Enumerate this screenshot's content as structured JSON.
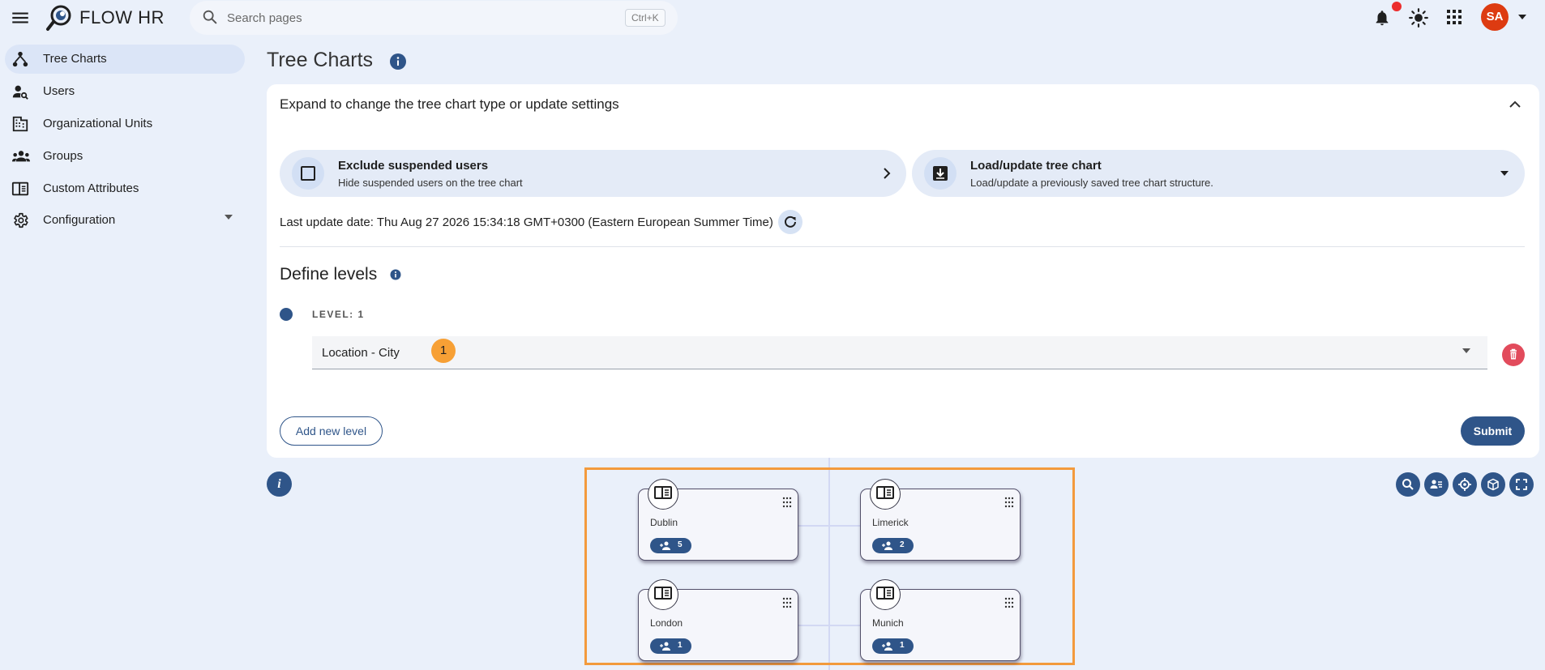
{
  "app": {
    "title": "FLOW HR"
  },
  "search": {
    "placeholder": "Search pages",
    "shortcut": "Ctrl+K"
  },
  "user": {
    "initials": "SA"
  },
  "colors": {
    "primary": "#2f5589",
    "accent": "#f39a3c",
    "danger": "#e24b5c",
    "avatar": "#dd3b11",
    "notification": "#ec2d2d"
  },
  "sidebar": {
    "items": [
      {
        "label": "Tree Charts",
        "icon": "tree-chart-icon",
        "active": true
      },
      {
        "label": "Users",
        "icon": "user-search-icon"
      },
      {
        "label": "Organizational Units",
        "icon": "building-icon"
      },
      {
        "label": "Groups",
        "icon": "groups-icon"
      },
      {
        "label": "Custom Attributes",
        "icon": "attributes-icon"
      },
      {
        "label": "Configuration",
        "icon": "gear-icon"
      }
    ]
  },
  "page": {
    "title": "Tree Charts"
  },
  "settings": {
    "expand_text": "Expand to change the tree chart type or update settings",
    "exclude": {
      "title": "Exclude suspended users",
      "subtitle": "Hide suspended users on the tree chart"
    },
    "load": {
      "title": "Load/update tree chart",
      "subtitle": "Load/update a previously saved tree chart structure."
    },
    "last_update": "Last update date: Thu Aug 27 2026 15:34:18 GMT+0300 (Eastern European Summer Time)"
  },
  "levels": {
    "title": "Define levels",
    "items": [
      {
        "label": "LEVEL: 1",
        "value": "Location - City",
        "badge": "1"
      }
    ],
    "add_label": "Add new level",
    "submit_label": "Submit"
  },
  "chart": {
    "info_glyph": "i",
    "nodes": [
      {
        "name": "Dublin",
        "count": "5"
      },
      {
        "name": "Limerick",
        "count": "2"
      },
      {
        "name": "London",
        "count": "1"
      },
      {
        "name": "Munich",
        "count": "1"
      }
    ]
  }
}
